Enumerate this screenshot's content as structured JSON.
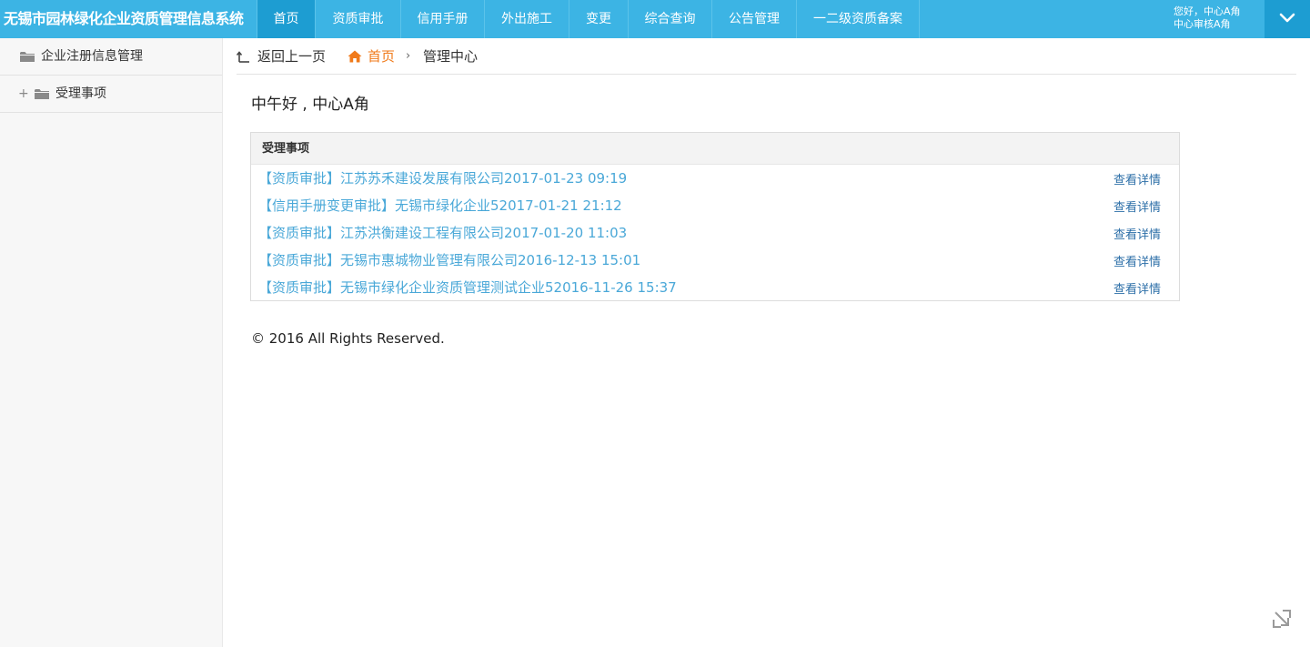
{
  "app": {
    "title": "无锡市园林绿化企业资质管理信息系统"
  },
  "nav": [
    {
      "label": "首页",
      "active": true
    },
    {
      "label": "资质审批"
    },
    {
      "label": "信用手册"
    },
    {
      "label": "外出施工"
    },
    {
      "label": "变更"
    },
    {
      "label": "综合查询"
    },
    {
      "label": "公告管理"
    },
    {
      "label": "一二级资质备案"
    }
  ],
  "user": {
    "greeting_line": "您好，中心A角",
    "role_line": "中心审核A角"
  },
  "sidebar": {
    "items": [
      {
        "label": "企业注册信息管理",
        "icon": "folder-icon"
      },
      {
        "label": "受理事项",
        "icon": "folder-icon",
        "expander": "+"
      }
    ]
  },
  "breadcrumb": {
    "back_label": "返回上一页",
    "home_label": "首页",
    "separator": "›",
    "current": "管理中心"
  },
  "main": {
    "greeting": "中午好 , 中心A角",
    "panel_title": "受理事项",
    "items": [
      {
        "title": "【资质审批】江苏苏禾建设发展有限公司2017-01-23 09:19",
        "action": "查看详情"
      },
      {
        "title": "【信用手册变更审批】无锡市绿化企业52017-01-21 21:12",
        "action": "查看详情"
      },
      {
        "title": "【资质审批】江苏洪衡建设工程有限公司2017-01-20 11:03",
        "action": "查看详情"
      },
      {
        "title": "【资质审批】无锡市惠城物业管理有限公司2016-12-13 15:01",
        "action": "查看详情"
      },
      {
        "title": "【资质审批】无锡市绿化企业资质管理测试企业52016-11-26 15:37",
        "action": "查看详情"
      }
    ]
  },
  "footer": {
    "copyright": "© 2016 All Rights Reserved."
  },
  "colors": {
    "topbar": "#3cb4e4",
    "topbar_active": "#1d9dd2",
    "link": "#4aa8d8",
    "detail_link": "#2d6fa8",
    "home_accent": "#f07a1a"
  }
}
